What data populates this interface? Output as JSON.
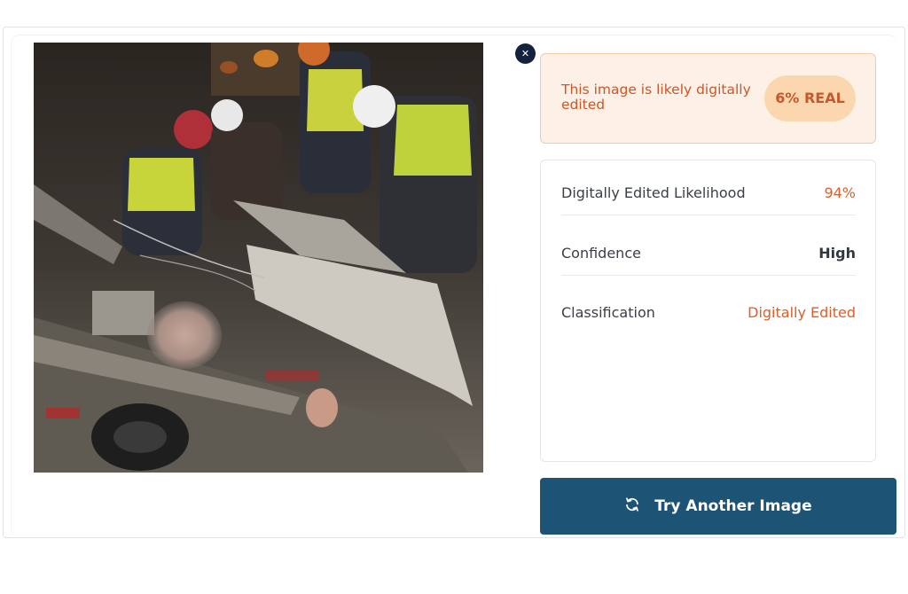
{
  "result": {
    "verdict_text": "This image is likely digitally edited",
    "score_label": "6% REAL"
  },
  "details": {
    "rows": [
      {
        "label": "Digitally Edited Likelihood",
        "value": "94%"
      },
      {
        "label": "Confidence",
        "value": "High"
      },
      {
        "label": "Classification",
        "value": "Digitally Edited"
      }
    ]
  },
  "actions": {
    "close_icon": "close-icon",
    "try_another_label": "Try Another Image",
    "try_another_icon": "refresh-icon"
  },
  "colors": {
    "accent_orange": "#e05d26",
    "verdict_bg": "#fdf0e6",
    "pill_bg": "#fbd7b0",
    "button_bg": "#1d5476",
    "close_bg": "#13233d"
  }
}
